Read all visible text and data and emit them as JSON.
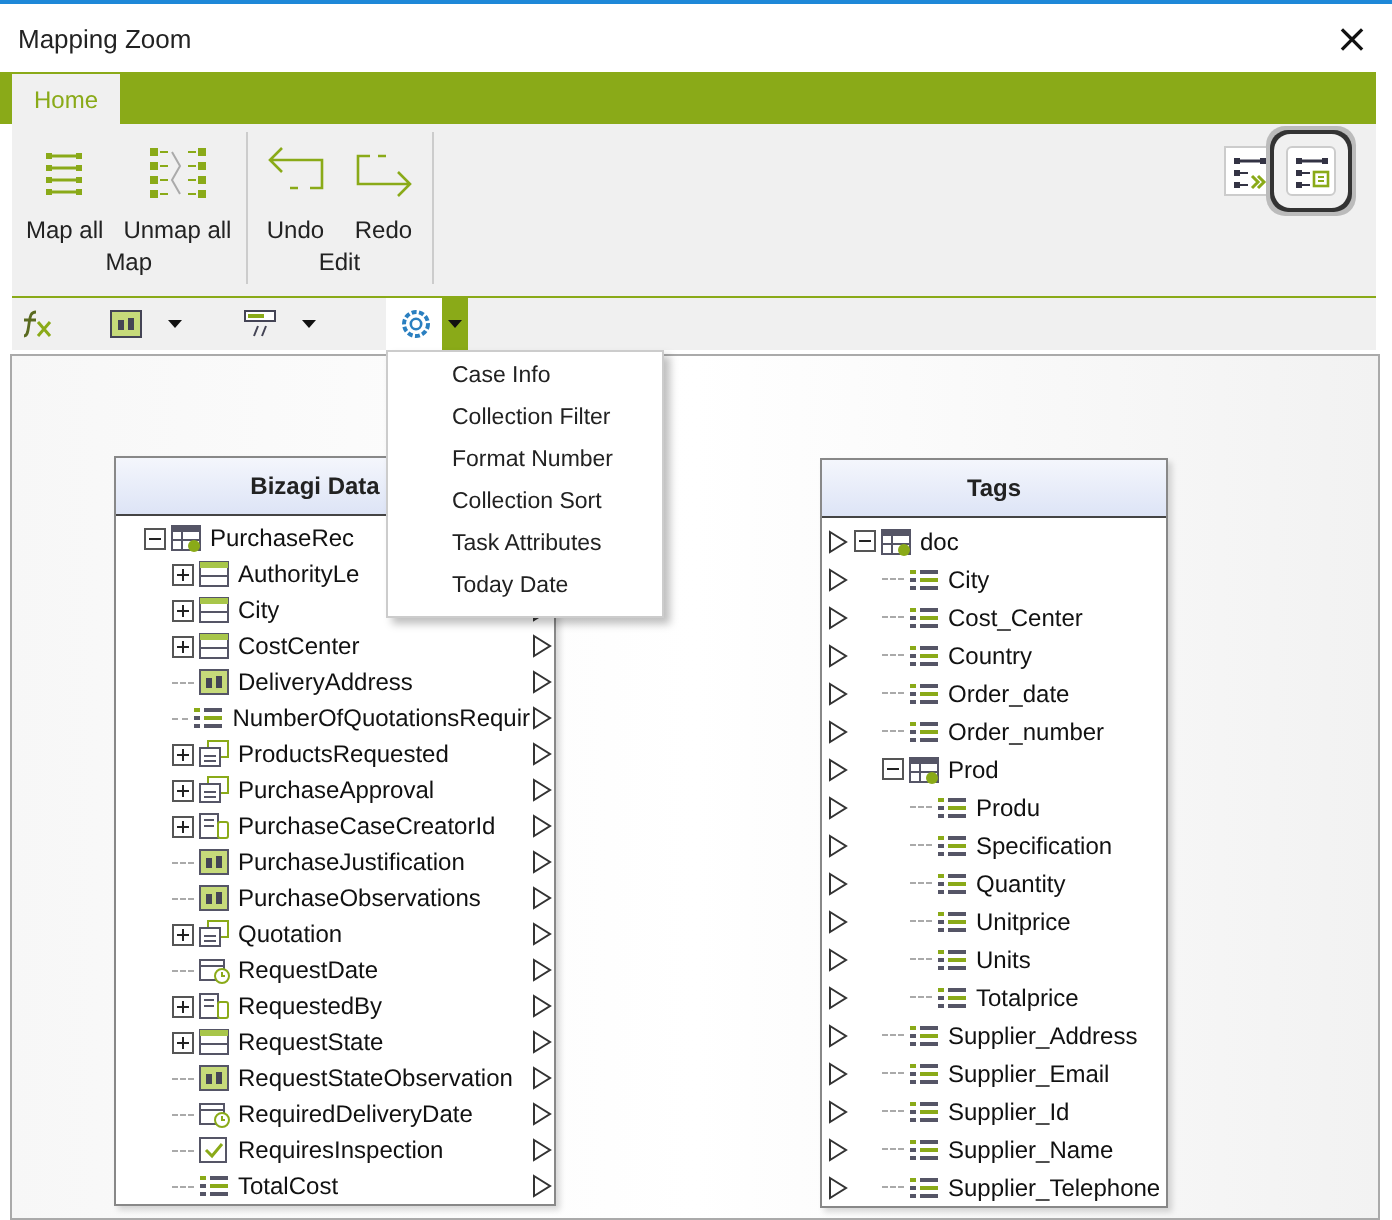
{
  "window": {
    "title": "Mapping Zoom",
    "close": "×"
  },
  "ribbon": {
    "tabs": [
      {
        "label": "Home",
        "selected": true
      }
    ],
    "groups": [
      {
        "name": "Map",
        "buttons": [
          {
            "label": "Map all",
            "kind": "mapall"
          },
          {
            "label": "Unmap all",
            "kind": "unmap"
          }
        ]
      },
      {
        "name": "Edit",
        "buttons": [
          {
            "label": "Undo",
            "kind": "undo"
          },
          {
            "label": "Redo",
            "kind": "redo"
          }
        ]
      }
    ],
    "view_buttons": [
      {
        "kind": "autolink",
        "highlighted": false
      },
      {
        "kind": "schema",
        "highlighted": true
      }
    ]
  },
  "formula_bar": {
    "tools": [
      {
        "kind": "fx",
        "dropdown": false
      },
      {
        "kind": "text",
        "dropdown": true,
        "open": false
      },
      {
        "kind": "format",
        "dropdown": true,
        "open": false
      },
      {
        "kind": "gear",
        "dropdown": true,
        "open": true
      }
    ],
    "menu": [
      "Case Info",
      "Collection Filter",
      "Format Number",
      "Collection Sort",
      "Task Attributes",
      "Today Date"
    ]
  },
  "left_panel": {
    "title": "Bizagi Data",
    "items": [
      {
        "label": "PurchaseRec",
        "kind": "root",
        "expanded": true,
        "port": false,
        "children": [
          {
            "label": "AuthorityLe",
            "kind": "entity",
            "expanded": false,
            "port": false
          },
          {
            "label": "City",
            "kind": "entity",
            "expanded": false,
            "port": true
          },
          {
            "label": "CostCenter",
            "kind": "entity",
            "expanded": false,
            "port": true
          },
          {
            "label": "DeliveryAddress",
            "kind": "text",
            "port": true
          },
          {
            "label": "NumberOfQuotationsRequir",
            "kind": "list",
            "port": true
          },
          {
            "label": "ProductsRequested",
            "kind": "collection",
            "expanded": false,
            "port": true
          },
          {
            "label": "PurchaseApproval",
            "kind": "collection",
            "expanded": false,
            "port": true
          },
          {
            "label": "PurchaseCaseCreatorId",
            "kind": "record",
            "expanded": false,
            "port": true
          },
          {
            "label": "PurchaseJustification",
            "kind": "text",
            "port": true
          },
          {
            "label": "PurchaseObservations",
            "kind": "text",
            "port": true
          },
          {
            "label": "Quotation",
            "kind": "collection",
            "expanded": false,
            "port": true
          },
          {
            "label": "RequestDate",
            "kind": "date",
            "port": true
          },
          {
            "label": "RequestedBy",
            "kind": "record",
            "expanded": false,
            "port": true
          },
          {
            "label": "RequestState",
            "kind": "entity",
            "expanded": false,
            "port": true
          },
          {
            "label": "RequestStateObservation",
            "kind": "text",
            "port": true
          },
          {
            "label": "RequiredDeliveryDate",
            "kind": "date",
            "port": true
          },
          {
            "label": "RequiresInspection",
            "kind": "boolean",
            "port": true
          },
          {
            "label": "TotalCost",
            "kind": "list",
            "port": true
          }
        ]
      }
    ]
  },
  "right_panel": {
    "title": "Tags",
    "items": [
      {
        "label": "doc",
        "kind": "group",
        "expanded": true,
        "children": [
          {
            "label": "City",
            "kind": "tag"
          },
          {
            "label": "Cost_Center",
            "kind": "tag"
          },
          {
            "label": "Country",
            "kind": "tag"
          },
          {
            "label": "Order_date",
            "kind": "tag"
          },
          {
            "label": "Order_number",
            "kind": "tag"
          },
          {
            "label": "Prod",
            "kind": "group",
            "expanded": true,
            "children": [
              {
                "label": "Produ",
                "kind": "tag"
              },
              {
                "label": "Specification",
                "kind": "tag"
              },
              {
                "label": "Quantity",
                "kind": "tag"
              },
              {
                "label": "Unitprice",
                "kind": "tag"
              },
              {
                "label": "Units",
                "kind": "tag"
              },
              {
                "label": "Totalprice",
                "kind": "tag"
              }
            ]
          },
          {
            "label": "Supplier_Address",
            "kind": "tag"
          },
          {
            "label": "Supplier_Email",
            "kind": "tag"
          },
          {
            "label": "Supplier_Id",
            "kind": "tag"
          },
          {
            "label": "Supplier_Name",
            "kind": "tag"
          },
          {
            "label": "Supplier_Telephone",
            "kind": "tag"
          }
        ]
      }
    ]
  }
}
